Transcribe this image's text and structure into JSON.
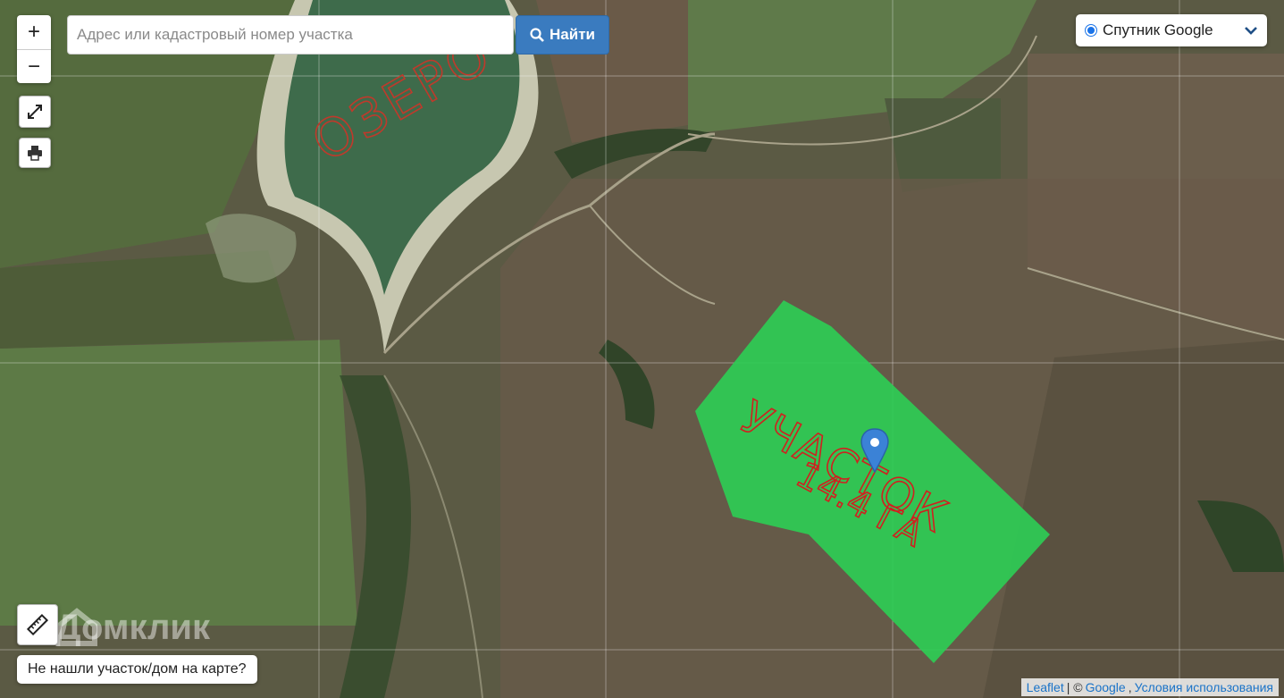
{
  "map": {
    "lake_label": "ОЗЕРО",
    "plot_label_line1": "УЧАСТОК",
    "plot_label_line2": "14.4 ГА",
    "plot_color": "#2ecc55",
    "annotation_color": "#d11f1f",
    "marker_color": "#3b82d6",
    "watermark": "Домклик"
  },
  "controls": {
    "zoom_in": "+",
    "zoom_out": "−",
    "fullscreen_icon": "expand-icon",
    "print_icon": "printer-icon",
    "ruler_icon": "ruler-icon"
  },
  "search": {
    "placeholder": "Адрес или кадастровый номер участка",
    "value": "",
    "button_label": "Найти"
  },
  "layer_select": {
    "selected": "Спутник Google"
  },
  "not_found_button": "Не нашли участок/дом на карте?",
  "attribution": {
    "leaflet": "Leaflet",
    "separator": "| ©",
    "google": "Google",
    "comma": ",",
    "terms": "Условия использования"
  }
}
